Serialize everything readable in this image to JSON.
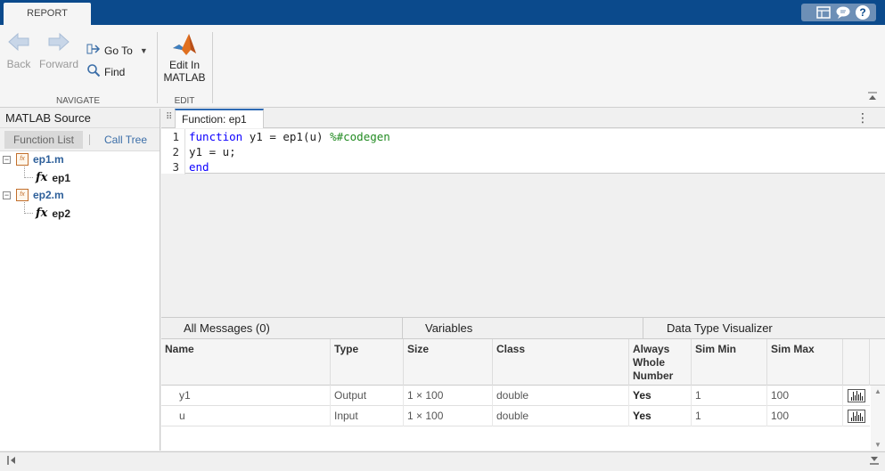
{
  "topbar": {
    "tab_label": "REPORT",
    "icons": [
      "layout-icon",
      "comment-icon",
      "help-icon"
    ],
    "help_glyph": "?"
  },
  "toolstrip": {
    "navigate": {
      "section_label": "NAVIGATE",
      "back_label": "Back",
      "forward_label": "Forward",
      "goto_label": "Go To",
      "find_label": "Find"
    },
    "edit": {
      "section_label": "EDIT",
      "edit_line1": "Edit In",
      "edit_line2": "MATLAB"
    }
  },
  "left_panel": {
    "title": "MATLAB Source",
    "tabs": [
      "Function List",
      "Call Tree"
    ],
    "tree": [
      {
        "file": "ep1.m",
        "function": "ep1"
      },
      {
        "file": "ep2.m",
        "function": "ep2"
      }
    ],
    "fx_glyph": "fx"
  },
  "editor": {
    "tab_label": "Function: ep1",
    "lines": [
      {
        "num": "1",
        "kw": "function",
        "text": " y1 = ep1(u) ",
        "comment": "%#codegen"
      },
      {
        "num": "2",
        "kw": "",
        "text": "y1 = u;",
        "comment": ""
      },
      {
        "num": "3",
        "kw": "end",
        "text": "",
        "comment": ""
      }
    ]
  },
  "bottom_tabs": [
    "All Messages (0)",
    "Variables",
    "Data Type Visualizer"
  ],
  "variables_table": {
    "columns": [
      "Name",
      "Type",
      "Size",
      "Class",
      "Always Whole Number",
      "Sim Min",
      "Sim Max"
    ],
    "rows": [
      {
        "name": "y1",
        "type": "Output",
        "size": "1 × 100",
        "class": "double",
        "whole": "Yes",
        "min": "1",
        "max": "100"
      },
      {
        "name": "u",
        "type": "Input",
        "size": "1 × 100",
        "class": "double",
        "whole": "Yes",
        "min": "1",
        "max": "100"
      }
    ]
  },
  "colors": {
    "title_bar": "#0b4a8c",
    "link": "#2d5f9a",
    "keyword": "#0e00ff",
    "comment": "#228b22"
  }
}
